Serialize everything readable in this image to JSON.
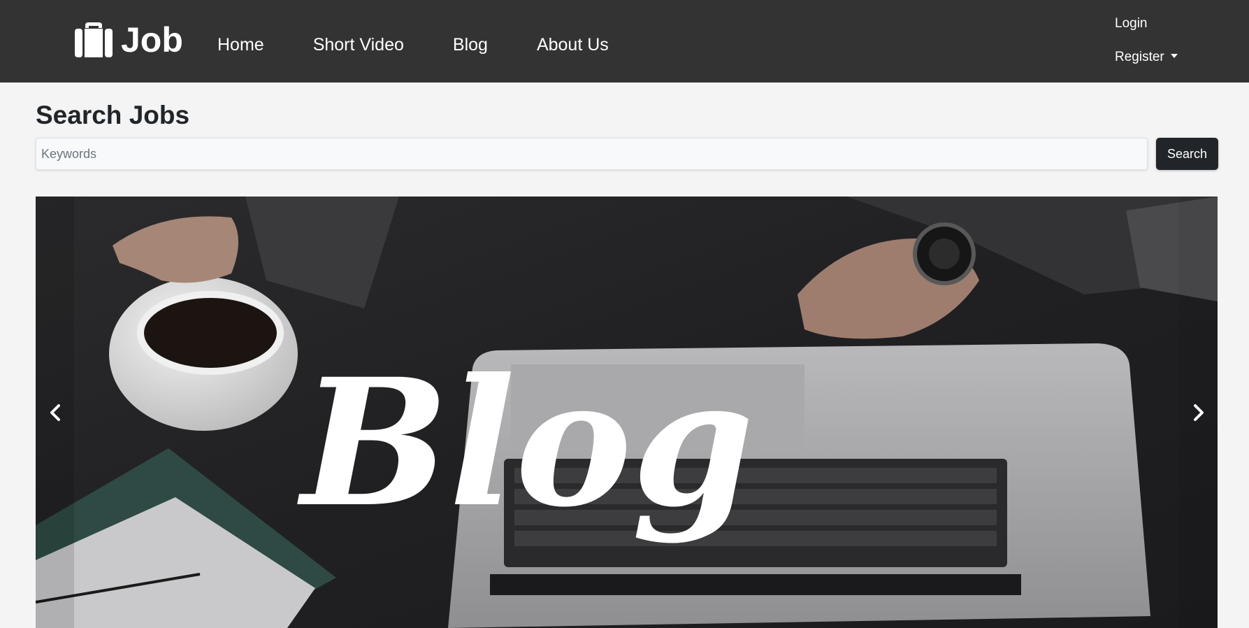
{
  "brand": {
    "name": "Job",
    "icon": "briefcase-icon"
  },
  "nav": {
    "items": [
      {
        "label": "Home"
      },
      {
        "label": "Short Video"
      },
      {
        "label": "Blog"
      },
      {
        "label": "About Us"
      }
    ]
  },
  "auth": {
    "login_label": "Login",
    "register_label": "Register"
  },
  "search": {
    "title": "Search Jobs",
    "placeholder": "Keywords",
    "value": "",
    "button_label": "Search"
  },
  "carousel": {
    "slide_text": "Blog",
    "prev_icon": "chevron-left-icon",
    "next_icon": "chevron-right-icon"
  },
  "colors": {
    "navbar_bg": "#333333",
    "page_bg": "#f4f4f4",
    "button_bg": "#212529",
    "text_primary": "#212529"
  }
}
